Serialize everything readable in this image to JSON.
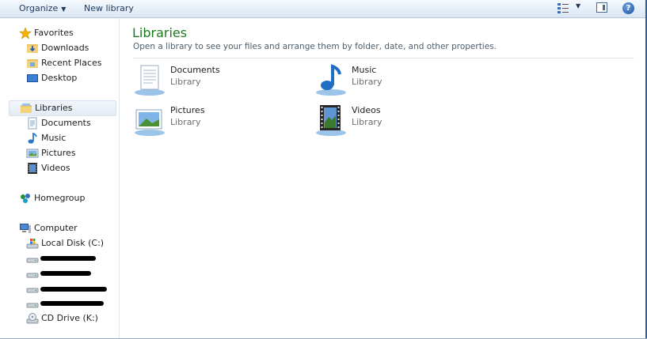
{
  "toolbar": {
    "organize": "Organize",
    "new_library": "New library"
  },
  "nav": {
    "favorites": "Favorites",
    "downloads": "Downloads",
    "recent_places": "Recent Places",
    "desktop": "Desktop",
    "libraries": "Libraries",
    "documents": "Documents",
    "music": "Music",
    "pictures": "Pictures",
    "videos": "Videos",
    "homegroup": "Homegroup",
    "computer": "Computer",
    "local_disk": "Local Disk (C:)",
    "cd_drive": "CD Drive (K:)"
  },
  "content": {
    "title": "Libraries",
    "subtitle": "Open a library to see your files and arrange them by folder, date, and other properties.",
    "libraries": [
      {
        "name": "Documents",
        "kind": "Library"
      },
      {
        "name": "Music",
        "kind": "Library"
      },
      {
        "name": "Pictures",
        "kind": "Library"
      },
      {
        "name": "Videos",
        "kind": "Library"
      }
    ]
  },
  "colors": {
    "title_green": "#1d7a1d",
    "accent_blue": "#1e395b"
  }
}
